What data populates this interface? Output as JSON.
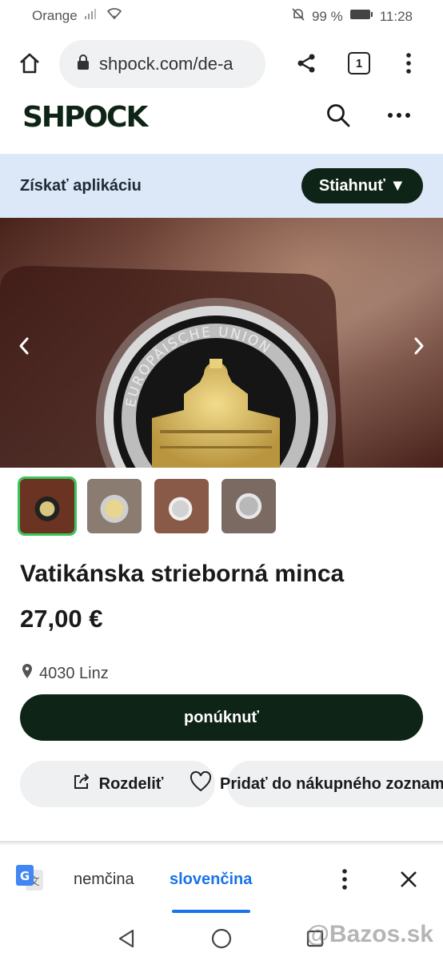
{
  "status": {
    "carrier": "Orange",
    "battery": "99 %",
    "time": "11:28"
  },
  "browser": {
    "url": "shpock.com/de-a",
    "tab_count": "1"
  },
  "site": {
    "logo": "SHPOCK"
  },
  "banner": {
    "text": "Získať aplikáciu",
    "button": "Stiahnuť ▼"
  },
  "coin_text": "EUROPÄISCHE UNION",
  "product": {
    "title": "Vatikánska strieborná minca",
    "price": "27,00 €",
    "location": "4030 Linz",
    "offer_button": "ponúknuť",
    "share_button": "Rozdeliť",
    "wishlist_button": "Pridať do nákupného zoznamu"
  },
  "translate": {
    "source_lang": "nemčina",
    "target_lang": "slovenčina"
  },
  "watermark": "@Bazos.sk",
  "colors": {
    "brand_dark": "#0e2417",
    "banner_bg": "#dce8f7",
    "accent_blue": "#1a73e8",
    "selected_green": "#3ec45a"
  }
}
